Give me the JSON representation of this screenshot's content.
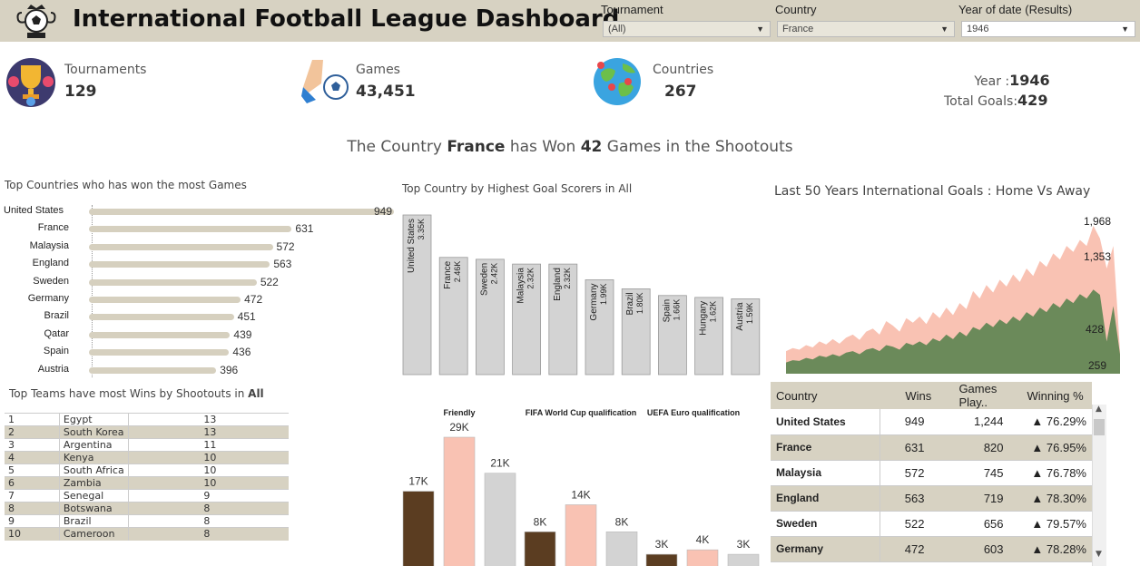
{
  "header": {
    "title": "International Football League Dashboard",
    "filters": [
      {
        "label": "Tournament",
        "value": "(All)"
      },
      {
        "label": "Country",
        "value": "France"
      },
      {
        "label": "Year of date (Results)",
        "value": "1946"
      }
    ]
  },
  "kpis": {
    "tournaments": {
      "label": "Tournaments",
      "value": "129",
      "icon": "trophy-icon"
    },
    "games": {
      "label": "Games",
      "value": "43,451",
      "icon": "kick-ball-icon"
    },
    "countries": {
      "label": "Countries",
      "value": "267",
      "icon": "globe-icon"
    },
    "year_label": "Year :",
    "year_value": "1946",
    "total_goals_label": "Total Goals:",
    "total_goals_value": "429"
  },
  "headline": {
    "prefix": "The Country",
    "country": "France",
    "mid": "has Won",
    "count": "42",
    "suffix": "Games  in the Shootouts"
  },
  "shootout_table": {
    "title_prefix": "Top  Teams  have most Wins by Shootouts in",
    "title_bold": "All",
    "rows": [
      {
        "rank": "1",
        "team": "Egypt",
        "wins": "13"
      },
      {
        "rank": "2",
        "team": "South Korea",
        "wins": "13"
      },
      {
        "rank": "3",
        "team": "Argentina",
        "wins": "11"
      },
      {
        "rank": "4",
        "team": "Kenya",
        "wins": "10"
      },
      {
        "rank": "5",
        "team": "South Africa",
        "wins": "10"
      },
      {
        "rank": "6",
        "team": "Zambia",
        "wins": "10"
      },
      {
        "rank": "7",
        "team": "Senegal",
        "wins": "9"
      },
      {
        "rank": "8",
        "team": "Botswana",
        "wins": "8"
      },
      {
        "rank": "9",
        "team": "Brazil",
        "wins": "8"
      },
      {
        "rank": "10",
        "team": "Cameroon",
        "wins": "8"
      }
    ]
  },
  "win_table": {
    "headers": [
      "Country",
      "Wins",
      "Games Play..",
      "Winning %"
    ],
    "rows": [
      {
        "country": "United States",
        "wins": "949",
        "games": "1,244",
        "pct": "▲ 76.29%"
      },
      {
        "country": "France",
        "wins": "631",
        "games": "820",
        "pct": "▲ 76.95%"
      },
      {
        "country": "Malaysia",
        "wins": "572",
        "games": "745",
        "pct": "▲ 76.78%"
      },
      {
        "country": "England",
        "wins": "563",
        "games": "719",
        "pct": "▲ 78.30%"
      },
      {
        "country": "Sweden",
        "wins": "522",
        "games": "656",
        "pct": "▲ 79.57%"
      },
      {
        "country": "Germany",
        "wins": "472",
        "games": "603",
        "pct": "▲ 78.28%"
      }
    ]
  },
  "colors": {
    "header_bg": "#d7d2c2",
    "bar_tan": "#d6d0bf",
    "bar_gray": "#d3d3d3",
    "home_green": "#6b8a5a",
    "away_pink": "#f9c2b3",
    "dark_brown": "#5b3d21"
  },
  "chart_data": [
    {
      "type": "bar",
      "orientation": "horizontal",
      "title": "Top Countries who  has won the most Games",
      "categories": [
        "United States",
        "France",
        "Malaysia",
        "England",
        "Sweden",
        "Germany",
        "Brazil",
        "Qatar",
        "Spain",
        "Austria"
      ],
      "values": [
        949,
        631,
        572,
        563,
        522,
        472,
        451,
        439,
        436,
        396
      ],
      "value_labels": [
        "949",
        "631",
        "572",
        "563",
        "522",
        "472",
        "451",
        "439",
        "436",
        "396"
      ]
    },
    {
      "type": "bar",
      "title": "Top Country by Highest  Goal Scorers in All",
      "categories": [
        "United States",
        "France",
        "Sweden",
        "Malaysia",
        "England",
        "Germany",
        "Brazil",
        "Spain",
        "Hungary",
        "Austria"
      ],
      "values": [
        3350,
        2460,
        2420,
        2320,
        2320,
        1990,
        1800,
        1660,
        1620,
        1590
      ],
      "value_labels": [
        "3.35K",
        "2.46K",
        "2.42K",
        "2.32K",
        "2.32K",
        "1.99K",
        "1.80K",
        "1.66K",
        "1.62K",
        "1.59K"
      ]
    },
    {
      "type": "area",
      "title": "Last 50 Years International Goals : Home Vs Away",
      "series": [
        {
          "values": [
            300,
            340,
            320,
            380,
            350,
            430,
            390,
            460,
            400,
            480,
            520,
            450,
            560,
            600,
            520,
            700,
            640,
            560,
            740,
            680,
            760,
            660,
            820,
            740,
            880,
            780,
            940,
            860,
            1100,
            1000,
            1180,
            1080,
            1250,
            1160,
            1320,
            1220,
            1400,
            1300,
            1500,
            1420,
            1600,
            1520,
            1700,
            1620,
            1780,
            1700,
            1968,
            1800,
            1400,
            1700,
            300
          ]
        },
        {
          "values": [
            150,
            180,
            170,
            210,
            190,
            240,
            220,
            260,
            230,
            280,
            300,
            260,
            320,
            340,
            300,
            380,
            360,
            320,
            410,
            380,
            430,
            380,
            470,
            430,
            520,
            460,
            560,
            500,
            620,
            580,
            680,
            620,
            720,
            660,
            760,
            700,
            820,
            760,
            880,
            820,
            940,
            880,
            1000,
            940,
            1060,
            1000,
            1120,
            1050,
            428,
            900,
            259
          ]
        }
      ],
      "annotations": [
        "1,968",
        "1,353",
        "428",
        "259"
      ],
      "ylim": [
        0,
        2100
      ]
    },
    {
      "type": "bar",
      "groups": [
        "Friendly",
        "FIFA World Cup qualification",
        "UEFA Euro qualification"
      ],
      "series_colors": [
        "#5b3d21",
        "#f9c2b3",
        "#d3d3d3"
      ],
      "values": [
        [
          17000,
          29000,
          21000
        ],
        [
          8000,
          14000,
          8000
        ],
        [
          3000,
          4000,
          3000
        ]
      ],
      "value_labels": [
        [
          "17K",
          "29K",
          "21K"
        ],
        [
          "8K",
          "14K",
          "8K"
        ],
        [
          "3K",
          "4K",
          "3K"
        ]
      ]
    }
  ]
}
